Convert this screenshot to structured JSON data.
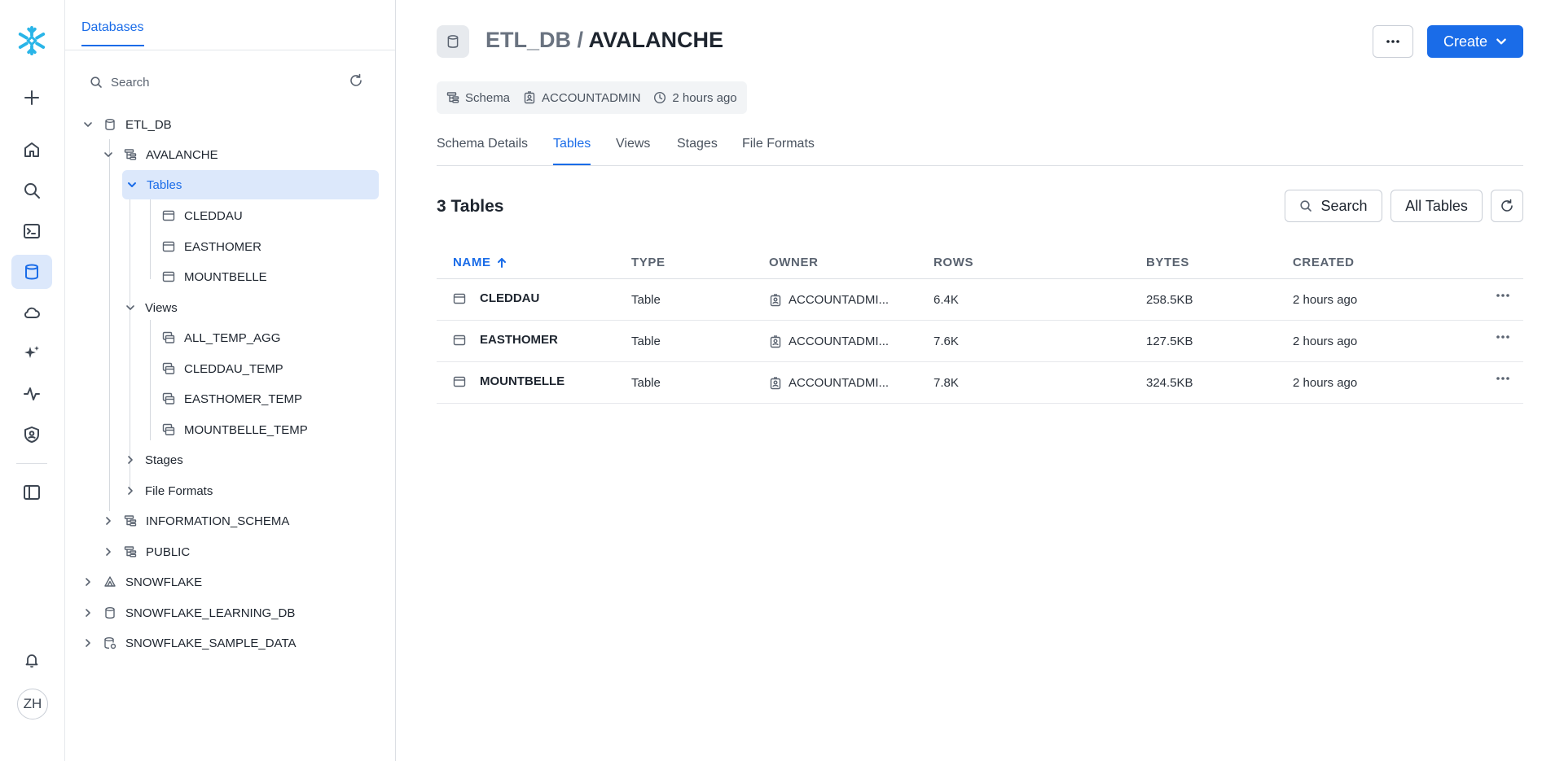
{
  "rail": {
    "logo": "snowflake-logo",
    "avatar_initials": "ZH",
    "accent": "#1a6ce8"
  },
  "explorer": {
    "tab_label": "Databases",
    "search_placeholder": "Search",
    "tree": [
      {
        "label": "ETL_DB"
      },
      {
        "label": "AVALANCHE"
      },
      {
        "label": "Tables"
      },
      {
        "label": "CLEDDAU"
      },
      {
        "label": "EASTHOMER"
      },
      {
        "label": "MOUNTBELLE"
      },
      {
        "label": "Views"
      },
      {
        "label": "ALL_TEMP_AGG"
      },
      {
        "label": "CLEDDAU_TEMP"
      },
      {
        "label": "EASTHOMER_TEMP"
      },
      {
        "label": "MOUNTBELLE_TEMP"
      },
      {
        "label": "Stages"
      },
      {
        "label": "File Formats"
      },
      {
        "label": "INFORMATION_SCHEMA"
      },
      {
        "label": "PUBLIC"
      },
      {
        "label": "SNOWFLAKE"
      },
      {
        "label": "SNOWFLAKE_LEARNING_DB"
      },
      {
        "label": "SNOWFLAKE_SAMPLE_DATA"
      }
    ]
  },
  "header": {
    "database": "ETL_DB",
    "separator": "/",
    "schema": "AVALANCHE",
    "create_label": "Create"
  },
  "meta": {
    "type": "Schema",
    "owner": "ACCOUNTADMIN",
    "created": "2 hours ago"
  },
  "tabs": [
    {
      "label": "Schema Details"
    },
    {
      "label": "Tables"
    },
    {
      "label": "Views"
    },
    {
      "label": "Stages"
    },
    {
      "label": "File Formats"
    }
  ],
  "table_section": {
    "count_label": "3 Tables",
    "search_label": "Search",
    "filter_label": "All Tables"
  },
  "table": {
    "columns": [
      "NAME",
      "TYPE",
      "OWNER",
      "ROWS",
      "BYTES",
      "CREATED"
    ],
    "rows": [
      {
        "name": "CLEDDAU",
        "type": "Table",
        "owner": "ACCOUNTADMI...",
        "rows": "6.4K",
        "bytes": "258.5KB",
        "created": "2 hours ago"
      },
      {
        "name": "EASTHOMER",
        "type": "Table",
        "owner": "ACCOUNTADMI...",
        "rows": "7.6K",
        "bytes": "127.5KB",
        "created": "2 hours ago"
      },
      {
        "name": "MOUNTBELLE",
        "type": "Table",
        "owner": "ACCOUNTADMI...",
        "rows": "7.8K",
        "bytes": "324.5KB",
        "created": "2 hours ago"
      }
    ]
  }
}
